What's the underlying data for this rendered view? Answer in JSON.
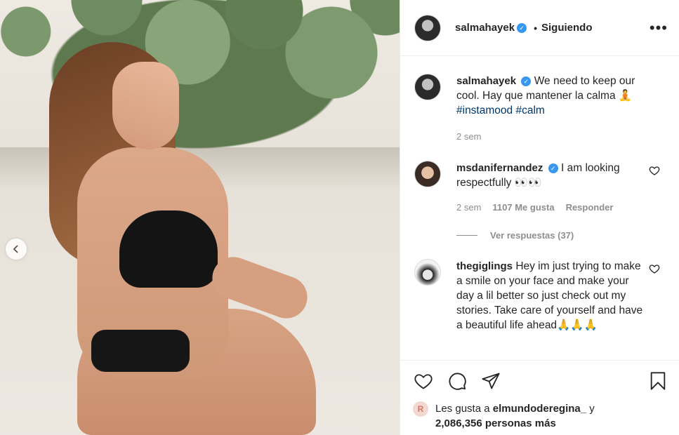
{
  "post_author": {
    "username": "salmahayek",
    "verified": true,
    "separator": "•",
    "follow_status": "Siguiendo"
  },
  "caption": {
    "username": "salmahayek",
    "text": "We need to keep our cool. Hay que mantener la calma 🧘",
    "hashtags": [
      "#instamood",
      "#calm"
    ],
    "time": "2 sem"
  },
  "comments": [
    {
      "username": "msdanifernandez",
      "verified": true,
      "text": "I am looking respectfully 👀👀",
      "time": "2 sem",
      "likes": "1107 Me gusta",
      "reply_label": "Responder",
      "view_replies": "Ver respuestas (37)"
    },
    {
      "username": "thegiglings",
      "verified": false,
      "text": "Hey im just trying to make a smile on your face and make your day a lil better so just check out my stories. Take care of yourself and have a beautiful life ahead🙏🙏🙏"
    }
  ],
  "likes_summary": {
    "prefix": "Les gusta a",
    "liker": "elmundoderegina_",
    "conjunction": "y",
    "others": "2,086,356 personas más",
    "avatar_letter": "R"
  },
  "icons": [
    "heart-icon",
    "comment-icon",
    "share-icon",
    "bookmark-icon",
    "more-icon",
    "chevron-left-icon",
    "verified-icon"
  ]
}
